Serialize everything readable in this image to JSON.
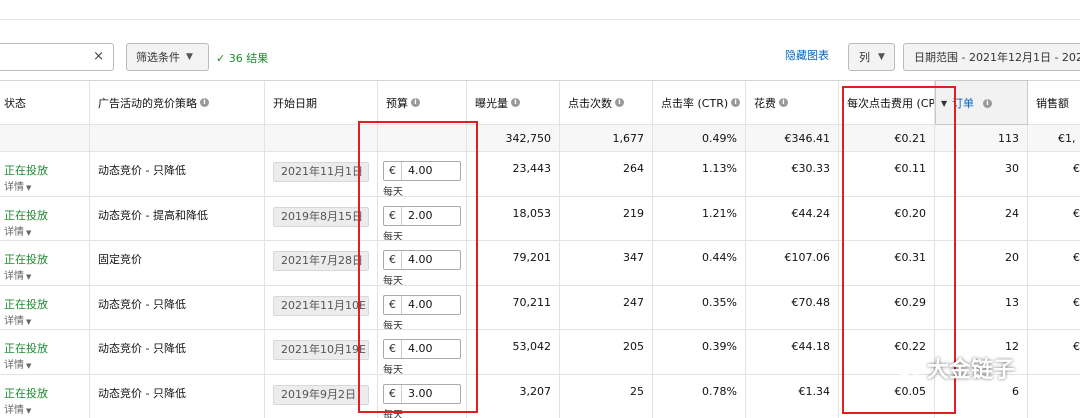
{
  "toolbar": {
    "clear_icon": "×",
    "filter_label": "筛选条件",
    "results_text": "✓ 36 结果",
    "hide_chart": "隐藏图表",
    "columns_label": "列",
    "date_range": "日期范围 - 2021年12月1日 - 202"
  },
  "headers": {
    "status": "状态",
    "strategy": "广告活动的竞价策略",
    "start_date": "开始日期",
    "budget": "预算",
    "impressions": "曝光量",
    "clicks": "点击次数",
    "ctr": "点击率 (CTR)",
    "spend": "花费",
    "cpc": "每次点击费用 (CPC)",
    "orders": "订单",
    "sales": "销售额"
  },
  "totals": {
    "impressions": "342,750",
    "clicks": "1,677",
    "ctr": "0.49%",
    "spend": "€346.41",
    "cpc": "€0.21",
    "orders": "113",
    "sales": "€1,"
  },
  "rows": [
    {
      "status": "正在投放",
      "details": "详情",
      "strategy": "动态竞价 - 只降低",
      "start_date": "2021年11月1日",
      "currency": "€",
      "budget": "4.00",
      "per_day": "每天",
      "impressions": "23,443",
      "clicks": "264",
      "ctr": "1.13%",
      "spend": "€30.33",
      "cpc": "€0.11",
      "orders": "30",
      "sales": "€"
    },
    {
      "status": "正在投放",
      "details": "详情",
      "strategy": "动态竞价 - 提高和降低",
      "start_date": "2019年8月15日",
      "currency": "€",
      "budget": "2.00",
      "per_day": "每天",
      "impressions": "18,053",
      "clicks": "219",
      "ctr": "1.21%",
      "spend": "€44.24",
      "cpc": "€0.20",
      "orders": "24",
      "sales": "€"
    },
    {
      "status": "正在投放",
      "details": "详情",
      "strategy": "固定竞价",
      "start_date": "2021年7月28日",
      "currency": "€",
      "budget": "4.00",
      "per_day": "每天",
      "impressions": "79,201",
      "clicks": "347",
      "ctr": "0.44%",
      "spend": "€107.06",
      "cpc": "€0.31",
      "orders": "20",
      "sales": "€"
    },
    {
      "status": "正在投放",
      "details": "详情",
      "strategy": "动态竞价 - 只降低",
      "start_date": "2021年11月10E",
      "currency": "€",
      "budget": "4.00",
      "per_day": "每天",
      "impressions": "70,211",
      "clicks": "247",
      "ctr": "0.35%",
      "spend": "€70.48",
      "cpc": "€0.29",
      "orders": "13",
      "sales": "€"
    },
    {
      "status": "正在投放",
      "details": "详情",
      "strategy": "动态竞价 - 只降低",
      "start_date": "2021年10月19E",
      "currency": "€",
      "budget": "4.00",
      "per_day": "每天",
      "impressions": "53,042",
      "clicks": "205",
      "ctr": "0.39%",
      "spend": "€44.18",
      "cpc": "€0.22",
      "orders": "12",
      "sales": "€"
    },
    {
      "status": "正在投放",
      "details": "详情",
      "strategy": "动态竞价 - 只降低",
      "start_date": "2019年9月2日",
      "currency": "€",
      "budget": "3.00",
      "per_day": "每天",
      "impressions": "3,207",
      "clicks": "25",
      "ctr": "0.78%",
      "spend": "€1.34",
      "cpc": "€0.05",
      "orders": "6",
      "sales": ""
    }
  ],
  "watermark": {
    "text": "大金链子"
  },
  "colors": {
    "status_green": "#1e8a30",
    "link_blue": "#0066c0",
    "highlight_red": "#e02020"
  }
}
